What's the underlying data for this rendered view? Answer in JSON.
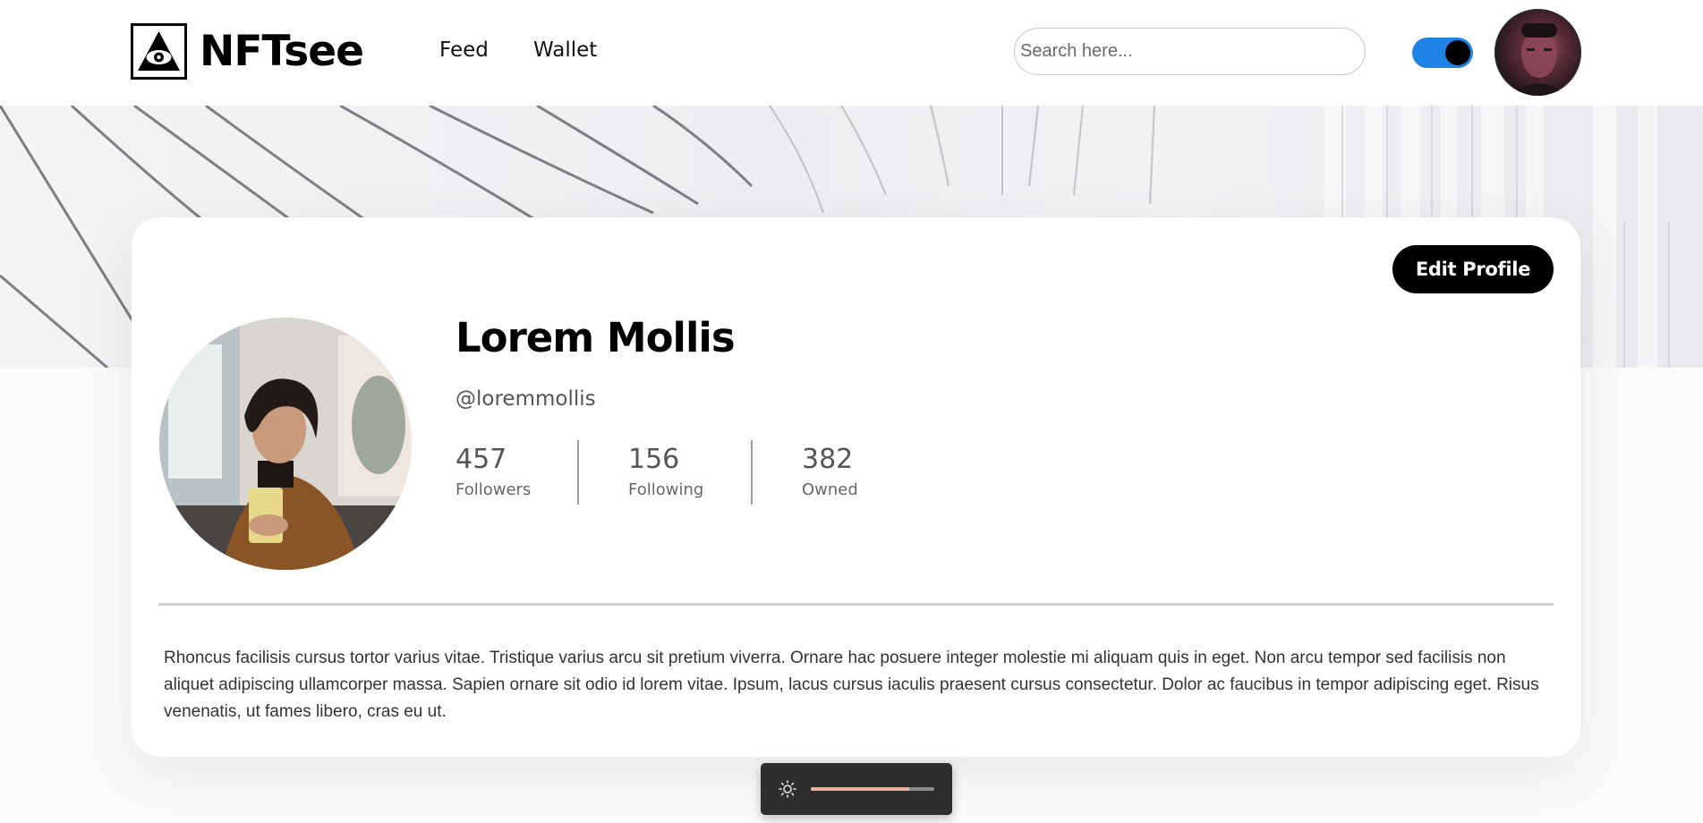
{
  "header": {
    "logo_icon": "eye-pyramid-icon",
    "brand": "NFTsee",
    "nav": [
      {
        "label": "Feed"
      },
      {
        "label": "Wallet"
      }
    ],
    "search": {
      "placeholder": "Search here...",
      "value": ""
    },
    "theme_toggle": {
      "on": true,
      "accent": "#1f82e6"
    },
    "avatar_icon": "user-avatar"
  },
  "profile": {
    "edit_label": "Edit Profile",
    "name": "Lorem Mollis",
    "handle": "@loremmollis",
    "stats": [
      {
        "value": "457",
        "label": "Followers"
      },
      {
        "value": "156",
        "label": "Following"
      },
      {
        "value": "382",
        "label": "Owned"
      }
    ],
    "bio": "Rhoncus facilisis cursus tortor varius vitae. Tristique varius arcu sit pretium viverra. Ornare hac posuere integer molestie mi aliquam quis in eget. Non arcu tempor sed facilisis non aliquet adipiscing ullamcorper massa. Sapien ornare sit odio id lorem vitae. Ipsum, lacus cursus iaculis praesent cursus consectetur. Dolor ac faucibus in tempor adipiscing eget. Risus venenatis, ut fames libero, cras eu ut."
  },
  "brightness_widget": {
    "icon": "sun-icon",
    "level": 0.8,
    "fill_color": "#e7b39a"
  }
}
